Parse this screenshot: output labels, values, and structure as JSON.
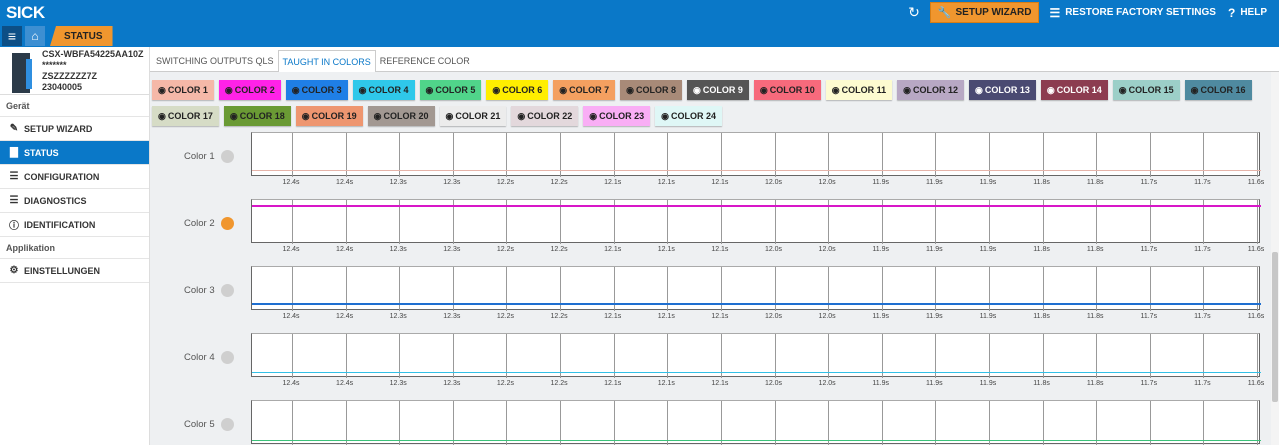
{
  "header": {
    "logo": "SICK",
    "setup_wizard": "SETUP WIZARD",
    "restore": "RESTORE FACTORY SETTINGS",
    "help": "HELP",
    "breadcrumb": "STATUS"
  },
  "device": {
    "line1": "CSX-WBFA54225AA10Z",
    "line2": "*******",
    "line3": "ZSZZZZZZ7Z",
    "line4": "23040005"
  },
  "sidebar": {
    "section1": "Gerät",
    "section2": "Applikation",
    "items": [
      "SETUP WIZARD",
      "STATUS",
      "CONFIGURATION",
      "DIAGNOSTICS",
      "IDENTIFICATION",
      "EINSTELLUNGEN"
    ]
  },
  "tabs": [
    "SWITCHING OUTPUTS QLS",
    "TAUGHT IN COLORS",
    "REFERENCE COLOR"
  ],
  "chips": [
    {
      "label": "COLOR 1",
      "color": "#f5b8a8",
      "dark": false
    },
    {
      "label": "COLOR 2",
      "color": "#ff22e8",
      "dark": false
    },
    {
      "label": "COLOR 3",
      "color": "#1f7fe6",
      "dark": false
    },
    {
      "label": "COLOR 4",
      "color": "#2fc8ea",
      "dark": false
    },
    {
      "label": "COLOR 5",
      "color": "#50d48a",
      "dark": false
    },
    {
      "label": "COLOR 6",
      "color": "#ffee00",
      "dark": false
    },
    {
      "label": "COLOR 7",
      "color": "#f4a060",
      "dark": false
    },
    {
      "label": "COLOR 8",
      "color": "#a88a78",
      "dark": false
    },
    {
      "label": "COLOR 9",
      "color": "#555555",
      "dark": true
    },
    {
      "label": "COLOR 10",
      "color": "#f76a7c",
      "dark": false
    },
    {
      "label": "COLOR 11",
      "color": "#fdfbd0",
      "dark": false
    },
    {
      "label": "COLOR 12",
      "color": "#b8a8c4",
      "dark": false
    },
    {
      "label": "COLOR 13",
      "color": "#4a4a72",
      "dark": true
    },
    {
      "label": "COLOR 14",
      "color": "#8c3c50",
      "dark": true
    },
    {
      "label": "COLOR 15",
      "color": "#9ccfc8",
      "dark": false
    },
    {
      "label": "COLOR 16",
      "color": "#4f8aa0",
      "dark": false
    },
    {
      "label": "COLOR 17",
      "color": "#d6dcc6",
      "dark": false
    },
    {
      "label": "COLOR 18",
      "color": "#6a9a34",
      "dark": false
    },
    {
      "label": "COLOR 19",
      "color": "#ee9670",
      "dark": false
    },
    {
      "label": "COLOR 20",
      "color": "#a29892",
      "dark": false
    },
    {
      "label": "COLOR 21",
      "color": "#ececec",
      "dark": false
    },
    {
      "label": "COLOR 22",
      "color": "#e3d8dc",
      "dark": false
    },
    {
      "label": "COLOR 23",
      "color": "#f9aef5",
      "dark": false
    },
    {
      "label": "COLOR 24",
      "color": "#dff7f6",
      "dark": false
    }
  ],
  "tick_labels": [
    "12.4s",
    "12.4s",
    "12.3s",
    "12.3s",
    "12.2s",
    "12.2s",
    "12.1s",
    "12.1s",
    "12.1s",
    "12.0s",
    "12.0s",
    "11.9s",
    "11.9s",
    "11.9s",
    "11.8s",
    "11.8s",
    "11.7s",
    "11.7s",
    "11.6s"
  ],
  "rows": [
    {
      "label": "Color 1",
      "dot": "#cfcfcf",
      "line_color": "#e6b4aa",
      "level": 0.88
    },
    {
      "label": "Color 2",
      "dot": "#f0962e",
      "line_color": "#d816c8",
      "level": 0.12
    },
    {
      "label": "Color 3",
      "dot": "#cfcfcf",
      "line_color": "#1f6fd0",
      "level": 0.86
    },
    {
      "label": "Color 4",
      "dot": "#cfcfcf",
      "line_color": "#33c0e6",
      "level": 0.9
    },
    {
      "label": "Color 5",
      "dot": "#cfcfcf",
      "line_color": "#3cc27a",
      "level": 0.92
    }
  ]
}
